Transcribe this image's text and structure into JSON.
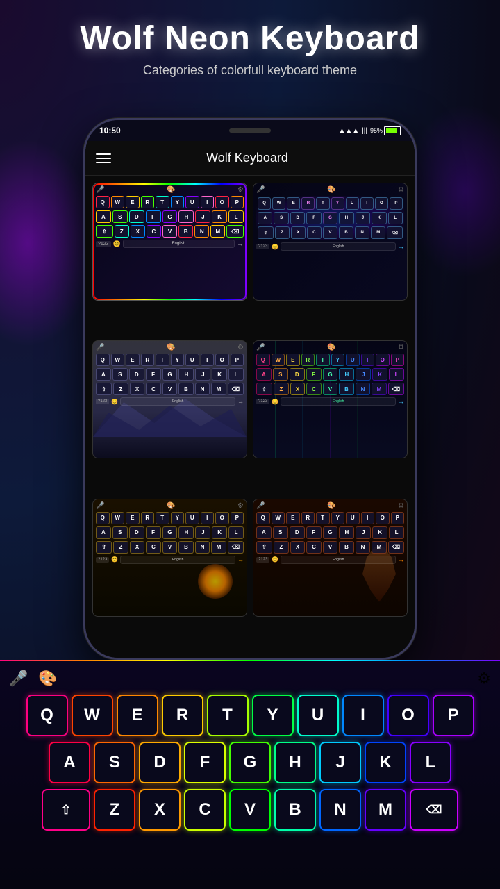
{
  "app": {
    "title": "Wolf Neon Keyboard",
    "subtitle": "Categories of colorfull keyboard theme"
  },
  "phone": {
    "status_time": "10:50",
    "battery": "95%",
    "app_name": "Wolf Keyboard"
  },
  "keyboard": {
    "rows": [
      [
        "Q",
        "W",
        "E",
        "R",
        "T",
        "Y",
        "U",
        "I",
        "O",
        "P"
      ],
      [
        "A",
        "S",
        "D",
        "F",
        "G",
        "H",
        "J",
        "K",
        "L"
      ],
      [
        "↑",
        "Z",
        "X",
        "C",
        "V",
        "B",
        "N",
        "M",
        "⌫"
      ]
    ],
    "bottom_row_left": "?123",
    "bottom_row_space": "English",
    "bottom_row_enter": "→"
  },
  "thumbnails": [
    {
      "id": 1,
      "label": "English",
      "style": "neon-rainbow"
    },
    {
      "id": 2,
      "label": "English",
      "style": "electric-blue"
    },
    {
      "id": 3,
      "label": "English",
      "style": "wolf-mountain"
    },
    {
      "id": 4,
      "label": "English",
      "style": "neon-green"
    },
    {
      "id": 5,
      "label": "English",
      "style": "golden-dragon"
    },
    {
      "id": 6,
      "label": "English",
      "style": "warrior"
    }
  ],
  "icons": {
    "menu": "☰",
    "microphone": "🎤",
    "sticker": "🎨",
    "settings": "⚙",
    "mic_unicode": "⊕",
    "backspace": "⌫",
    "shift": "⇧",
    "enter": "→",
    "wifi": "📶",
    "battery": "🔋"
  }
}
